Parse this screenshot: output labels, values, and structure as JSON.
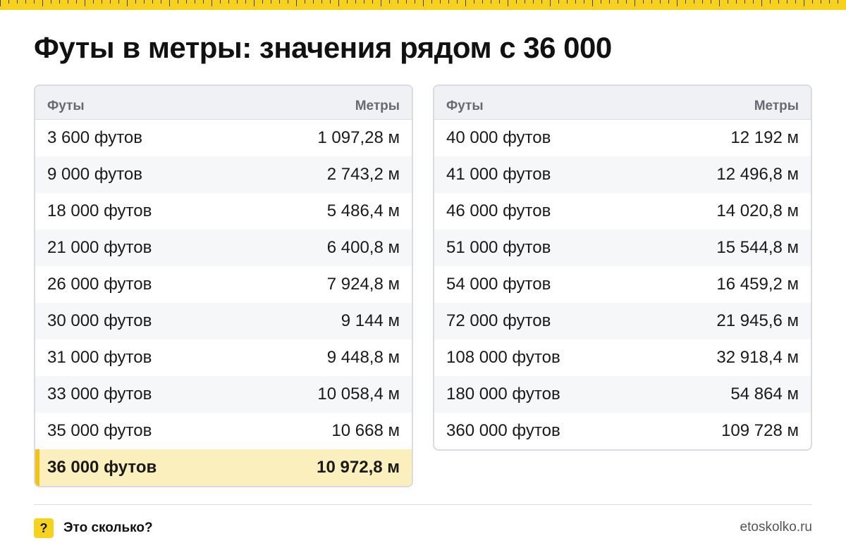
{
  "title": "Футы в метры: значения рядом с 36 000",
  "colors": {
    "accent": "#f7d21b",
    "highlight_bg": "#fbefbe",
    "highlight_bar": "#f2c40f"
  },
  "left_table": {
    "col_feet": "Футы",
    "col_meters": "Метры",
    "rows": [
      {
        "feet": "3 600 футов",
        "meters": "1 097,28 м"
      },
      {
        "feet": "9 000 футов",
        "meters": "2 743,2 м"
      },
      {
        "feet": "18 000 футов",
        "meters": "5 486,4 м"
      },
      {
        "feet": "21 000 футов",
        "meters": "6 400,8 м"
      },
      {
        "feet": "26 000 футов",
        "meters": "7 924,8 м"
      },
      {
        "feet": "30 000 футов",
        "meters": "9 144 м"
      },
      {
        "feet": "31 000 футов",
        "meters": "9 448,8 м"
      },
      {
        "feet": "33 000 футов",
        "meters": "10 058,4 м"
      },
      {
        "feet": "35 000 футов",
        "meters": "10 668 м"
      },
      {
        "feet": "36 000 футов",
        "meters": "10 972,8 м",
        "highlight": true
      }
    ]
  },
  "right_table": {
    "col_feet": "Футы",
    "col_meters": "Метры",
    "rows": [
      {
        "feet": "40 000 футов",
        "meters": "12 192 м"
      },
      {
        "feet": "41 000 футов",
        "meters": "12 496,8 м"
      },
      {
        "feet": "46 000 футов",
        "meters": "14 020,8 м"
      },
      {
        "feet": "51 000 футов",
        "meters": "15 544,8 м"
      },
      {
        "feet": "54 000 футов",
        "meters": "16 459,2 м"
      },
      {
        "feet": "72 000 футов",
        "meters": "21 945,6 м"
      },
      {
        "feet": "108 000 футов",
        "meters": "32 918,4 м"
      },
      {
        "feet": "180 000 футов",
        "meters": "54 864 м"
      },
      {
        "feet": "360 000 футов",
        "meters": "109 728 м"
      }
    ]
  },
  "footer": {
    "icon_glyph": "?",
    "icon_name": "question-icon",
    "brand": "Это сколько?",
    "site": "etoskolko.ru"
  }
}
